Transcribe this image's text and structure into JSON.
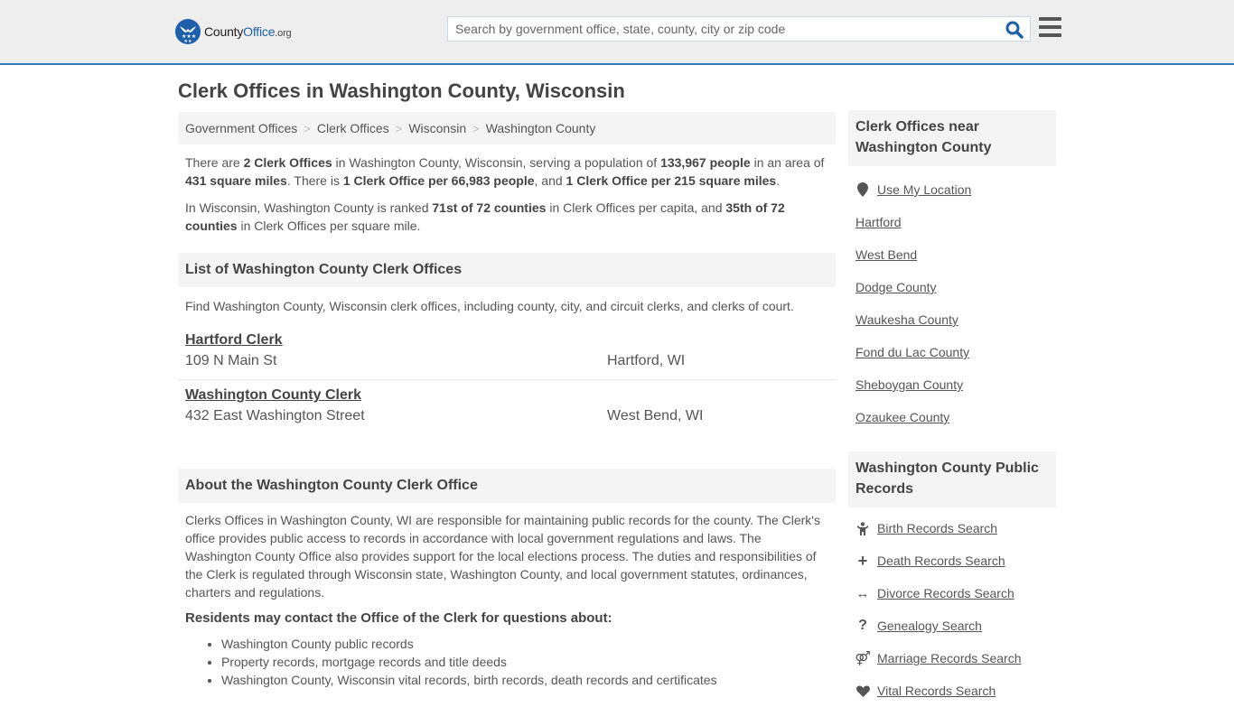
{
  "header": {
    "logo_text_prefix": "County",
    "logo_text_brand": "Office",
    "logo_text_suffix": ".org",
    "search_placeholder": "Search by government office, state, county, city or zip code",
    "search_value": "",
    "accent_color": "#337ab7"
  },
  "page": {
    "title": "Clerk Offices in Washington County, Wisconsin"
  },
  "breadcrumb": [
    {
      "label": "Government Offices"
    },
    {
      "label": "Clerk Offices"
    },
    {
      "label": "Wisconsin"
    },
    {
      "label": "Washington County"
    }
  ],
  "breadcrumb_separator": ">",
  "intro": {
    "p1": {
      "t1": "There are ",
      "b1": "2 Clerk Offices",
      "t2": " in Washington County, Wisconsin, serving a population of ",
      "b2": "133,967 people",
      "t3": " in an area of ",
      "b3": "431 square miles",
      "t4": ". There is ",
      "b4": "1 Clerk Office per 66,983 people",
      "t5": ", and ",
      "b5": "1 Clerk Office per 215 square miles",
      "t6": "."
    },
    "p2": {
      "t1": "In Wisconsin, Washington County is ranked ",
      "b1": "71st of 72 counties",
      "t2": " in Clerk Offices per capita, and ",
      "b2": "35th of 72 counties",
      "t3": " in Clerk Offices per square mile."
    }
  },
  "list_section": {
    "heading": "List of Washington County Clerk Offices",
    "description": "Find Washington County, Wisconsin clerk offices, including county, city, and circuit clerks, and clerks of court.",
    "offices": [
      {
        "name": "Hartford Clerk",
        "address": "109 N Main St",
        "city": "Hartford, WI"
      },
      {
        "name": "Washington County Clerk",
        "address": "432 East Washington Street",
        "city": "West Bend, WI"
      }
    ]
  },
  "about_section": {
    "heading": "About the Washington County Clerk Office",
    "text": "Clerks Offices in Washington County, WI are responsible for maintaining public records for the county. The Clerk's office provides public access to records in accordance with local government regulations and laws. The Washington County Office also provides support for the local elections process. The duties and responsibilities of the Clerk is regulated through Wisconsin state, Washington County, and local government statutes, ordinances, charters and regulations.",
    "subheading": "Residents may contact the Office of the Clerk for questions about:",
    "items": [
      "Washington County public records",
      "Property records, mortgage records and title deeds",
      "Washington County, Wisconsin vital records, birth records, death records and certificates"
    ]
  },
  "sidebar": {
    "nearby": {
      "heading": "Clerk Offices near Washington County",
      "use_location": {
        "label": "Use My Location",
        "icon": "map-marker-icon"
      },
      "links": [
        "Hartford",
        "West Bend",
        "Dodge County",
        "Waukesha County",
        "Fond du Lac County",
        "Sheboygan County",
        "Ozaukee County"
      ]
    },
    "records": {
      "heading": "Washington County Public Records",
      "links": [
        {
          "label": "Birth Records Search",
          "icon": "child-icon",
          "glyph": ""
        },
        {
          "label": "Death Records Search",
          "icon": "plus-icon",
          "glyph": "+"
        },
        {
          "label": "Divorce Records Search",
          "icon": "arrows-horizontal-icon",
          "glyph": "↔"
        },
        {
          "label": "Genealogy Search",
          "icon": "question-icon",
          "glyph": "?"
        },
        {
          "label": "Marriage Records Search",
          "icon": "venus-mars-icon",
          "glyph": "⚤"
        },
        {
          "label": "Vital Records Search",
          "icon": "heartbeat-icon",
          "glyph": ""
        }
      ]
    }
  }
}
